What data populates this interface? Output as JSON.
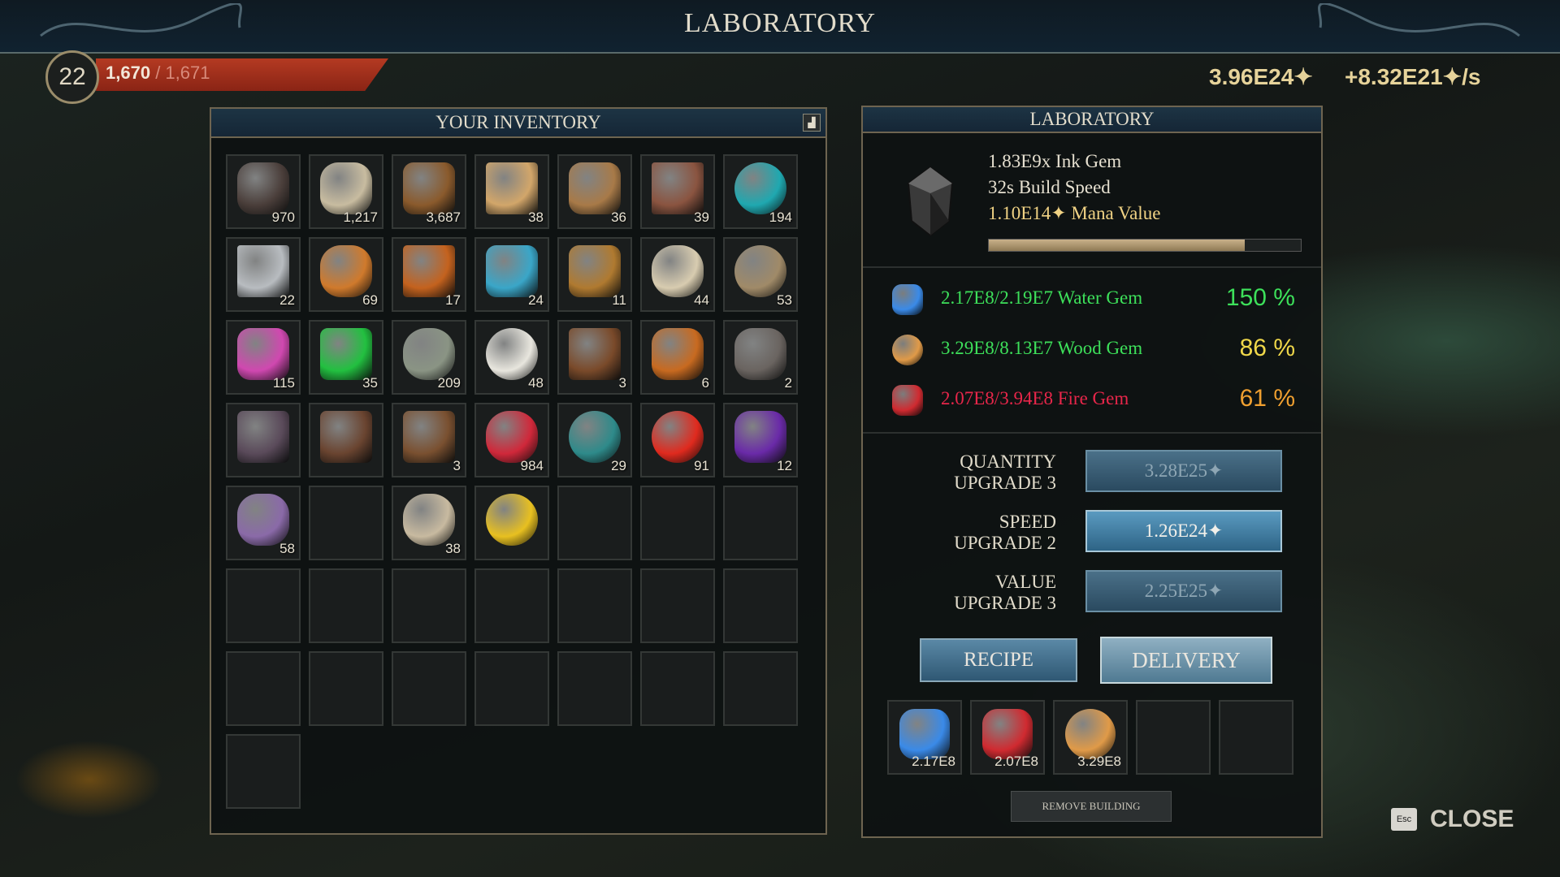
{
  "title": "LABORATORY",
  "player": {
    "level": "22",
    "xp_current": "1,670",
    "xp_max": "/ 1,671"
  },
  "mana": {
    "total": "3.96E24✦",
    "rate": "+8.32E21✦/s"
  },
  "inventory": {
    "title": "YOUR INVENTORY",
    "items": [
      {
        "icon": "stone-icon",
        "count": "970"
      },
      {
        "icon": "rock-icon",
        "count": "1,217"
      },
      {
        "icon": "log-icon",
        "count": "3,687"
      },
      {
        "icon": "plank-icon",
        "count": "38"
      },
      {
        "icon": "wood-log-icon",
        "count": "36"
      },
      {
        "icon": "leather-icon",
        "count": "39"
      },
      {
        "icon": "water-gem-egg-icon",
        "count": "194"
      },
      {
        "icon": "iron-bar-icon",
        "count": "22"
      },
      {
        "icon": "copper-ore-icon",
        "count": "69"
      },
      {
        "icon": "copper-bar-icon",
        "count": "17"
      },
      {
        "icon": "water-bucket-icon",
        "count": "24"
      },
      {
        "icon": "empty-bucket-icon",
        "count": "11"
      },
      {
        "icon": "bone-icon",
        "count": "44"
      },
      {
        "icon": "rope-icon",
        "count": "53"
      },
      {
        "icon": "pink-crystal-icon",
        "count": "115"
      },
      {
        "icon": "emerald-icon",
        "count": "35"
      },
      {
        "icon": "gray-stone-icon",
        "count": "209"
      },
      {
        "icon": "cotton-icon",
        "count": "48"
      },
      {
        "icon": "chest-icon",
        "count": "3"
      },
      {
        "icon": "campfire-icon",
        "count": "6"
      },
      {
        "icon": "well-icon",
        "count": "2"
      },
      {
        "icon": "house-icon",
        "count": ""
      },
      {
        "icon": "workshop-icon",
        "count": ""
      },
      {
        "icon": "cabin-icon",
        "count": "3"
      },
      {
        "icon": "strawberry-icon",
        "count": "984"
      },
      {
        "icon": "soup-bowl-icon",
        "count": "29"
      },
      {
        "icon": "tomato-icon",
        "count": "91"
      },
      {
        "icon": "grape-barrel-icon",
        "count": "12"
      },
      {
        "icon": "stew-pot-icon",
        "count": "58"
      },
      {
        "icon": "",
        "count": ""
      },
      {
        "icon": "mushroom-icon",
        "count": "38"
      },
      {
        "icon": "banana-icon",
        "count": ""
      }
    ]
  },
  "lab": {
    "title": "LABORATORY",
    "product": {
      "line1": "1.83E9x Ink Gem",
      "line2": "32s Build Speed",
      "value": "1.10E14✦",
      "value_label": "Mana Value",
      "progress": 0.82
    },
    "inputs": [
      {
        "icon": "water-gem-icon",
        "text": "2.17E8/2.19E7 Water Gem",
        "pct": "150 %",
        "color": "#3de05a",
        "pct_color": "#3de05a"
      },
      {
        "icon": "wood-gem-icon",
        "text": "3.29E8/8.13E7 Wood Gem",
        "pct": "86 %",
        "color": "#3de05a",
        "pct_color": "#f0d84a"
      },
      {
        "icon": "fire-gem-icon",
        "text": "2.07E8/3.94E8 Fire Gem",
        "pct": "61 %",
        "color": "#e8264a",
        "pct_color": "#f0a030"
      }
    ],
    "upgrades": [
      {
        "label1": "QUANTITY",
        "label2": "UPGRADE 3",
        "cost": "3.28E25✦",
        "enabled": false
      },
      {
        "label1": "SPEED",
        "label2": "UPGRADE 2",
        "cost": "1.26E24✦",
        "enabled": true
      },
      {
        "label1": "VALUE",
        "label2": "UPGRADE 3",
        "cost": "2.25E25✦",
        "enabled": false
      }
    ],
    "recipe_label": "RECIPE",
    "delivery_label": "DELIVERY",
    "outputs": [
      {
        "icon": "water-gem-icon",
        "count": "2.17E8"
      },
      {
        "icon": "fire-gem-icon",
        "count": "2.07E8"
      },
      {
        "icon": "wood-gem-icon",
        "count": "3.29E8"
      }
    ],
    "remove_label": "REMOVE BUILDING"
  },
  "close": {
    "key": "Esc",
    "label": "CLOSE"
  }
}
